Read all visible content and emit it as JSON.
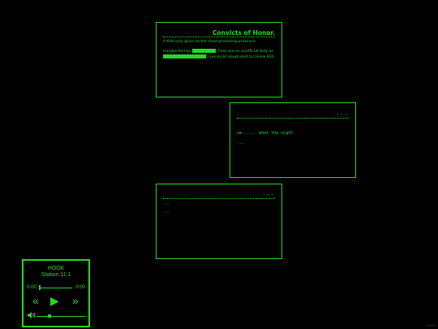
{
  "panel1": {
    "title": "Convicts of Honor.",
    "line1": "A title only given to the most promising prisoners.",
    "line2_start": "Handpicked by",
    "line2_end": ". They are on unofficial duty as",
    "line3_end": "'s personal squad sent to Glesie 832."
  },
  "panel2": {
    "dots": "...",
    "text": "um...... what the night",
    "ellipsis": "..."
  },
  "panel3": {
    "dots": "...",
    "line1": "...",
    "line2": "..."
  },
  "player": {
    "title": "HOOK",
    "station": "Station 11.1",
    "time_current": "0:00",
    "time_total": "0:00",
    "prev_icon": "«",
    "play_icon": "▶",
    "next_icon": "»",
    "volume_icon": "speaker-icon",
    "progress": 0,
    "volume": 0.25
  },
  "watermark": "Board"
}
